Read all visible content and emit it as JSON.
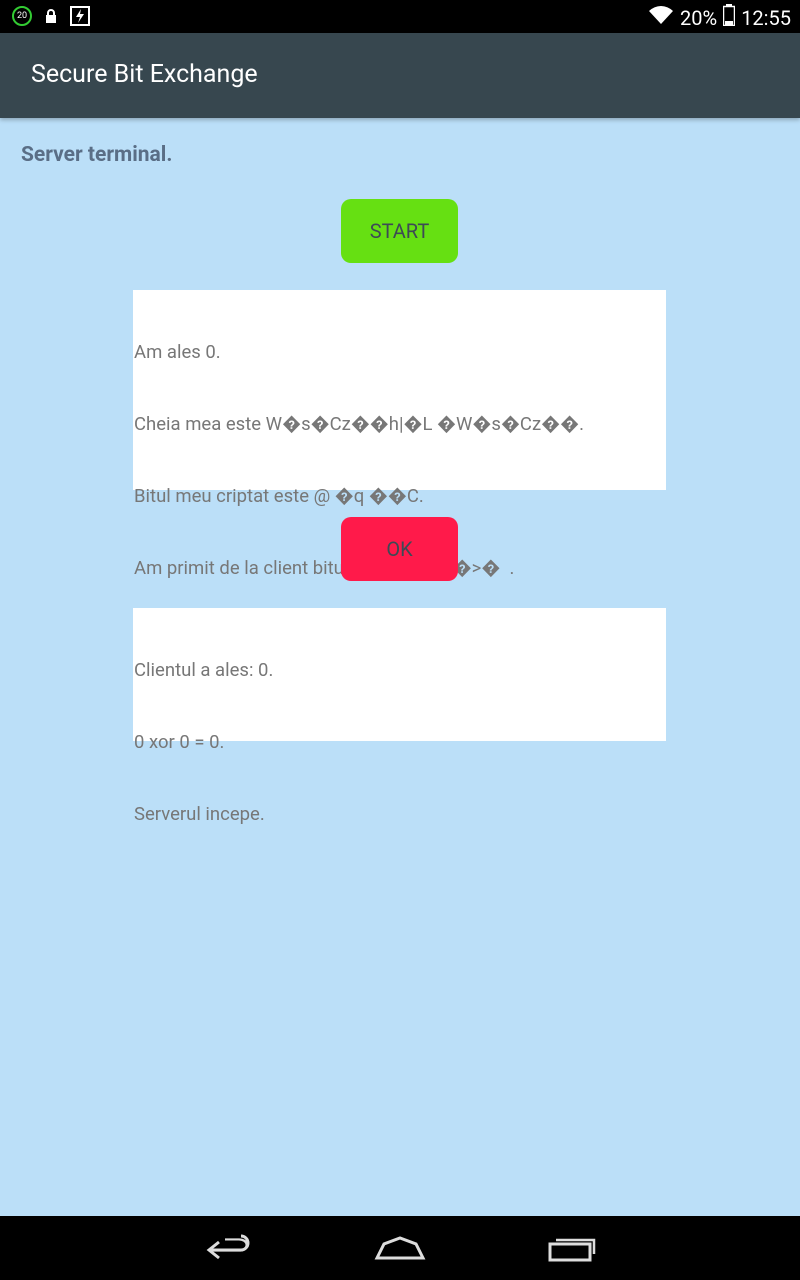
{
  "status_bar": {
    "notification_badge": "20",
    "battery_percent": "20%",
    "time": "12:55"
  },
  "app_bar": {
    "title": "Secure Bit Exchange"
  },
  "main": {
    "heading": "Server terminal.",
    "start_button": "START",
    "ok_button": "OK",
    "log_lines": [
      "Am ales 0.",
      "Cheia mea este W�s�Cz��h|�L �W�s�Cz��.",
      "Bitul meu criptat este @ �q ��C.",
      "Am primit de la client bitul criptat: xc��>�  ."
    ],
    "result_lines": [
      "Clientul a ales: 0.",
      "0 xor 0 = 0.",
      "Serverul incepe."
    ]
  },
  "colors": {
    "background": "#bbdff8",
    "app_bar": "#37474f",
    "start_button": "#66e012",
    "ok_button": "#ff1a4a"
  },
  "icons": [
    "notification-badge-icon",
    "lock-icon",
    "flash-icon",
    "wifi-icon",
    "battery-icon",
    "back-icon",
    "home-icon",
    "recents-icon"
  ]
}
